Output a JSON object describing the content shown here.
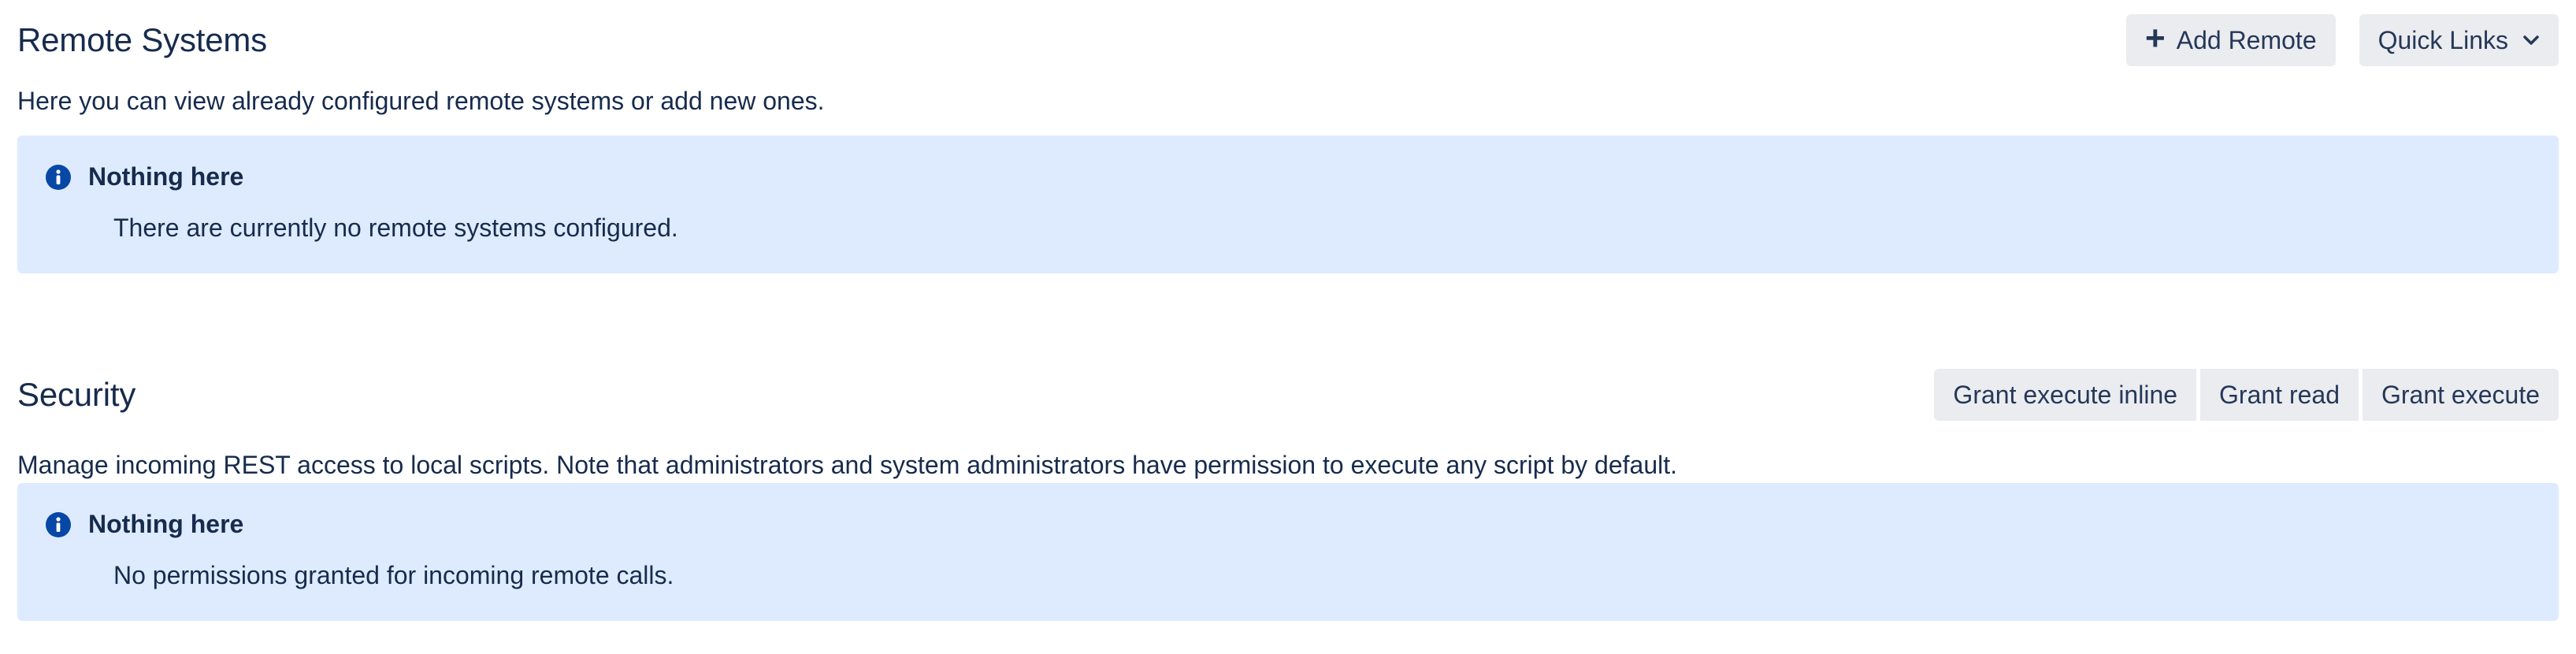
{
  "remote": {
    "title": "Remote Systems",
    "add_label": "Add Remote",
    "quick_links_label": "Quick Links",
    "description": "Here you can view already configured remote systems or add new ones.",
    "notice": {
      "title": "Nothing here",
      "body": "There are currently no remote systems configured."
    }
  },
  "security": {
    "title": "Security",
    "buttons": [
      {
        "label": "Grant execute inline"
      },
      {
        "label": "Grant read"
      },
      {
        "label": "Grant execute"
      }
    ],
    "description": "Manage incoming REST access to local scripts. Note that administrators and system administrators have permission to execute any script by default.",
    "notice": {
      "title": "Nothing here",
      "body": "No permissions granted for incoming remote calls."
    }
  },
  "colors": {
    "notice_bg": "#deebff",
    "info_icon": "#0747a6",
    "button_bg": "#ebecf0",
    "text": "#172b4d"
  },
  "icons": {
    "add": "plus-icon",
    "dropdown": "chevron-down-icon",
    "notice": "info-icon"
  }
}
